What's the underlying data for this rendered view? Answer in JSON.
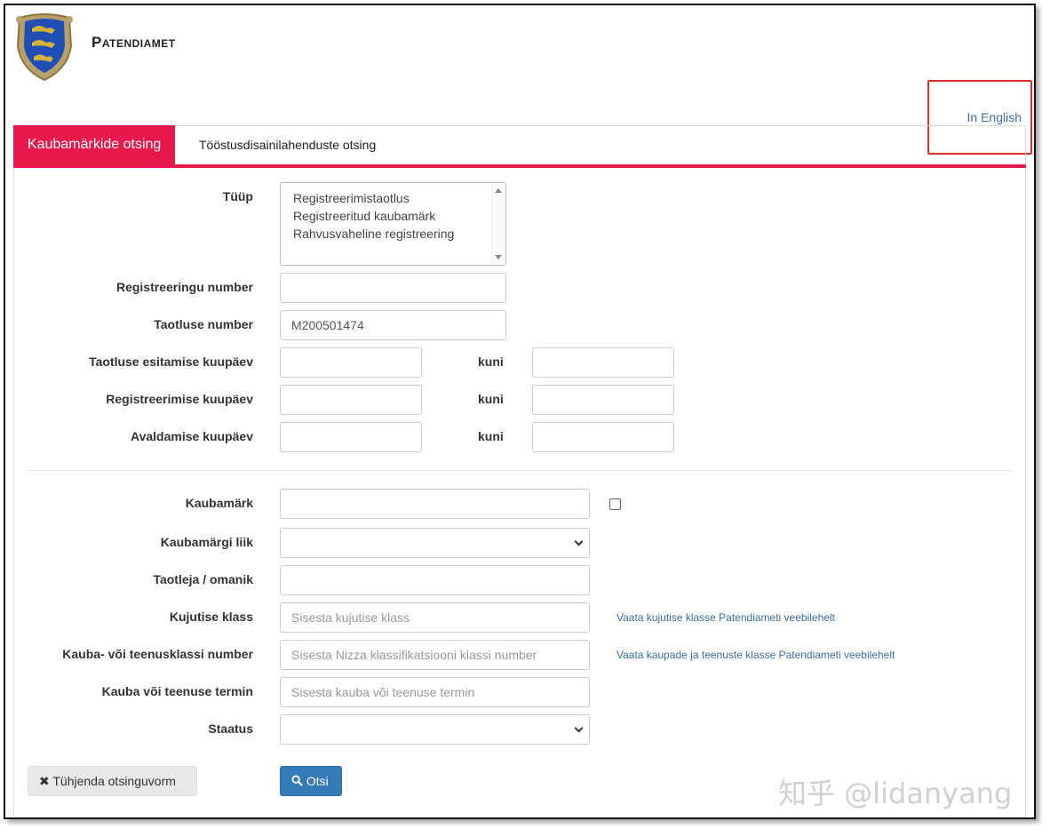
{
  "header": {
    "brand": "Patendiamet",
    "language_link": "In English"
  },
  "tabs": [
    {
      "label": "Kaubamärkide otsing",
      "active": true
    },
    {
      "label": "Tööstusdisainilahenduste otsing",
      "active": false
    }
  ],
  "colors": {
    "accent": "#e8194a",
    "link": "#3a6ea5",
    "primary_button": "#337ab7",
    "highlight_box": "#d9302a"
  },
  "form": {
    "type_label": "Tüüp",
    "type_options": [
      "Registreerimistaotlus",
      "Registreeritud kaubamärk",
      "Rahvusvaheline registreering"
    ],
    "registration_number_label": "Registreeringu number",
    "registration_number_value": "",
    "application_number_label": "Taotluse number",
    "application_number_value": "M200501474",
    "filing_date_label": "Taotluse esitamise kuupäev",
    "registration_date_label": "Registreerimise kuupäev",
    "publication_date_label": "Avaldamise kuupäev",
    "until_label": "kuni",
    "trademark_label": "Kaubamärk",
    "trademark_type_label": "Kaubamärgi liik",
    "applicant_owner_label": "Taotleja / omanik",
    "figurative_class_label": "Kujutise klass",
    "figurative_class_placeholder": "Sisesta kujutise klass",
    "figurative_class_link": "Vaata kujutise klasse Patendiameti veebilehelt",
    "goods_class_label": "Kauba- või teenusklassi number",
    "goods_class_placeholder": "Sisesta Nizza klassifikatsiooni klassi number",
    "goods_class_link": "Vaata kaupade ja teenuste klasse Patendiameti veebilehelt",
    "goods_term_label": "Kauba või teenuse termin",
    "goods_term_placeholder": "Sisesta kauba või teenuse termin",
    "status_label": "Staatus"
  },
  "buttons": {
    "clear_icon": "times-icon",
    "clear_label": "Tühjenda otsinguvorm",
    "search_icon": "search-icon",
    "search_label": "Otsi"
  },
  "watermark": "知乎 @lidanyang"
}
